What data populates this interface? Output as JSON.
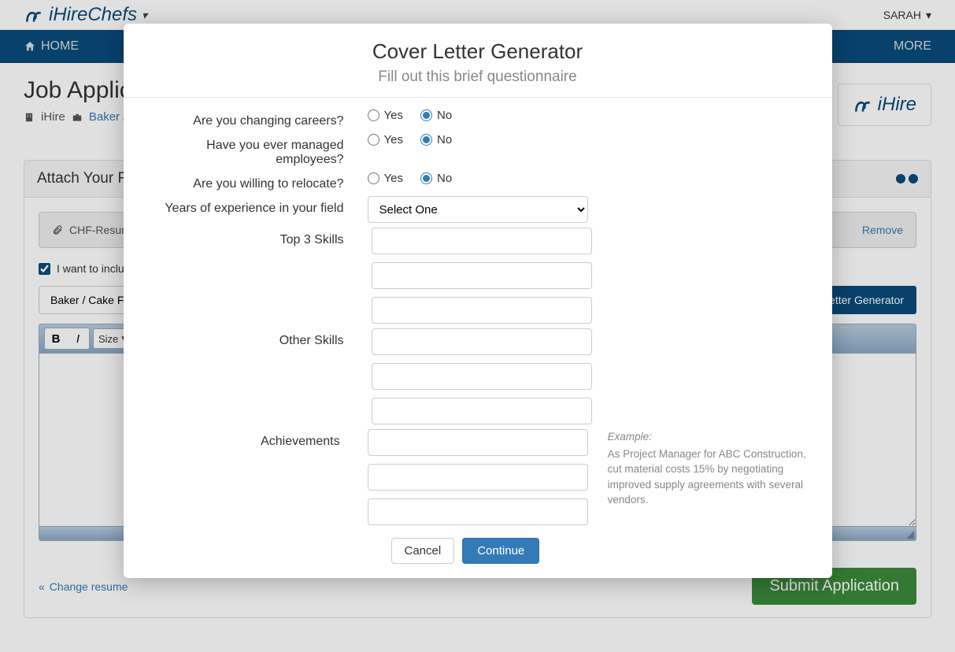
{
  "topbar": {
    "brand": "iHireChefs",
    "user": "SARAH"
  },
  "nav": {
    "home": "HOME",
    "more": "MORE"
  },
  "page": {
    "title": "Job Application",
    "crumb_company": "iHire",
    "crumb_job": "Baker / Cake…"
  },
  "panel": {
    "title": "Attach Your Resume",
    "file": "CHF-Resume…",
    "remove": "Remove",
    "checkbox_label": "I want to include a cover letter",
    "select_value": "Baker / Cake Finisher",
    "generator_btn": "Letter Generator",
    "size_label": "Size",
    "change_resume": "Change resume",
    "submit": "Submit Application"
  },
  "badge": {
    "text": "iHire"
  },
  "modal": {
    "title": "Cover Letter Generator",
    "subtitle": "Fill out this brief questionnaire",
    "q_careers": "Are you changing careers?",
    "q_managed": "Have you ever managed employees?",
    "q_relocate": "Are you willing to relocate?",
    "q_years": "Years of experience in your field",
    "q_top3": "Top 3 Skills",
    "q_other": "Other Skills",
    "q_achieve": "Achievements",
    "yes": "Yes",
    "no": "No",
    "years_placeholder": "Select One",
    "example_label": "Example:",
    "example_text": "As Project Manager for ABC Construction, cut material costs 15% by negotiating improved supply agreements with several vendors.",
    "cancel": "Cancel",
    "continue": "Continue"
  }
}
